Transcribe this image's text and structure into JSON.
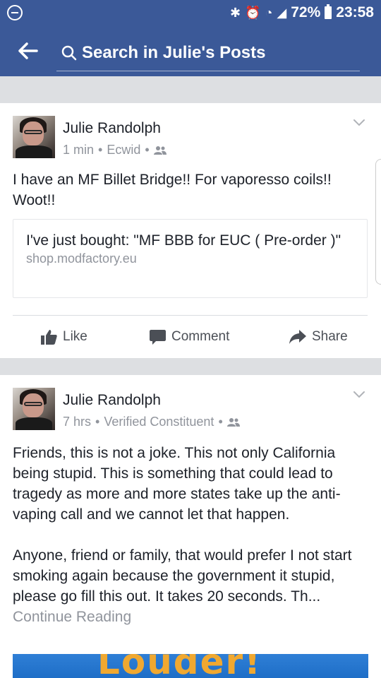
{
  "status_bar": {
    "battery": "72%",
    "time": "23:58"
  },
  "search": {
    "placeholder": "Search in Julie's Posts"
  },
  "posts": [
    {
      "author": "Julie Randolph",
      "time": "1 min",
      "source": "Ecwid",
      "text": "I have an MF Billet Bridge!! For vaporesso coils!! Woot!!",
      "link": {
        "title": "I've just bought: \"MF BBB for EUC ( Pre-order )\"",
        "domain": "shop.modfactory.eu"
      }
    },
    {
      "author": "Julie Randolph",
      "time": "7 hrs",
      "source": "Verified Constituent",
      "text_p1": "Friends, this is not a joke. This not only California being stupid. This is something that could lead to tragedy as more and more states take up the anti-vaping call and we cannot let that happen.",
      "text_p2": "Anyone, friend or family, that would prefer I not start smoking again because the government it stupid, please go fill this out. It takes 20 seconds. Th...",
      "continue_label": "Continue Reading",
      "image_text": "Louder!"
    }
  ],
  "actions": {
    "like": "Like",
    "comment": "Comment",
    "share": "Share"
  },
  "separator": "•"
}
